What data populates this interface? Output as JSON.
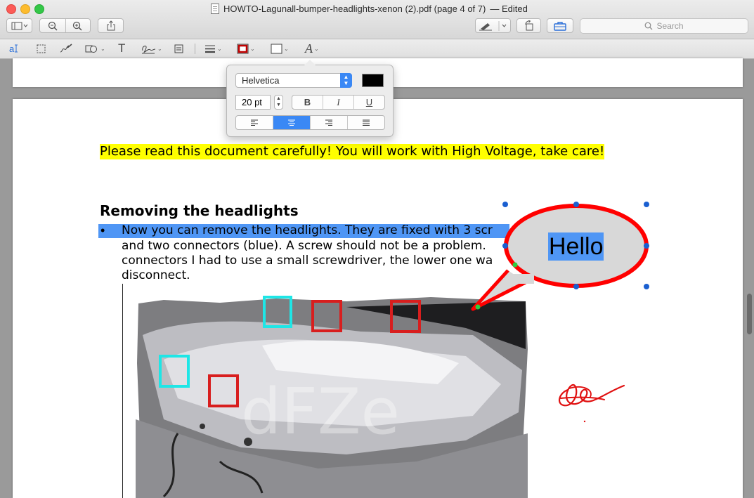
{
  "window": {
    "title": "HOWTO-Lagunall-bumper-headlights-xenon (2).pdf (page 4 of 7)",
    "edited": "— Edited"
  },
  "toolbar": {
    "search_placeholder": "Search"
  },
  "markup_toolbar": {
    "text_select_label": "a",
    "text_tool_label": "T",
    "font_tool_label": "A"
  },
  "font_popover": {
    "font_name": "Helvetica",
    "font_color": "#000000",
    "font_size": "20 pt",
    "bold": "B",
    "italic": "I",
    "underline": "U",
    "alignment_selected": "center"
  },
  "document": {
    "warning": "Please read this document carefully! You will work with High Voltage, take care!",
    "heading": "Removing the headlights",
    "bullet_mark": "•",
    "para_lines": [
      "Now you can remove the headlights. They are fixed with 3 scr",
      "and two connectors (blue). A screw should not be a problem.",
      "connectors I had to use a small screwdriver, the lower one wa",
      "disconnect."
    ],
    "watermark": "dFZe"
  },
  "annotation": {
    "callout_text": "Hello",
    "callout_color": "#ff0000",
    "selection_color": "#4f96f5"
  }
}
